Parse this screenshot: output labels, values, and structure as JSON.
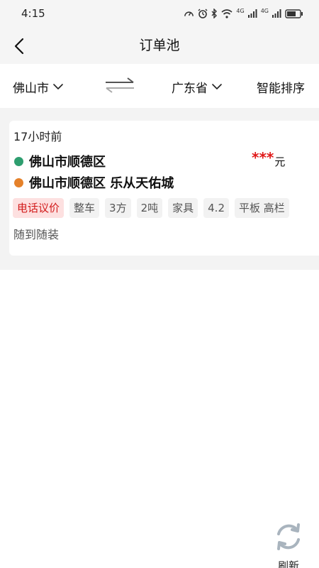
{
  "status_bar": {
    "time": "4:15",
    "network_label_1": "4G",
    "network_label_2": "4G"
  },
  "header": {
    "title": "订单池",
    "back_icon": "chevron-left-icon"
  },
  "filters": {
    "origin": "佛山市",
    "destination": "广东省",
    "sort": "智能排序",
    "swap_icon": "swap-arrows-icon",
    "dropdown_icon": "chevron-down-icon"
  },
  "orders": [
    {
      "time_ago": "17小时前",
      "from": "佛山市顺德区",
      "to": "佛山市顺德区 乐从天佑城",
      "price_masked": "***",
      "price_unit": "元",
      "tags": [
        "电话议价",
        "整车",
        "3方",
        "2吨",
        "家具",
        "4.2",
        "平板 高栏"
      ],
      "note": "随到随装"
    }
  ],
  "refresh": {
    "label": "刷新",
    "icon": "refresh-icon"
  },
  "colors": {
    "from_dot": "#2e9e6f",
    "to_dot": "#e5812a",
    "price_red": "#e01818",
    "tag_highlight_bg": "#fde0e0",
    "tag_highlight_text": "#d21c1c",
    "background_gray": "#f3f3f3"
  }
}
